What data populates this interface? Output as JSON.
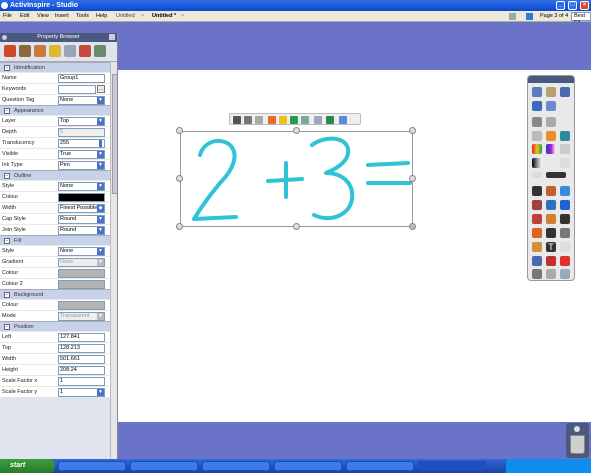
{
  "window": {
    "title": "ActivInspire - Studio"
  },
  "menu": [
    "File",
    "Edit",
    "View",
    "Insert",
    "Tools",
    "Help"
  ],
  "tabs": {
    "untitled_plain": "Untitled",
    "untitled_active": "Untitled *"
  },
  "pagebar": {
    "page_info": "Page 3 of 4",
    "zoom": "Best Fit"
  },
  "property_browser": {
    "title": "Property Browser",
    "sections": {
      "identification": "Identification",
      "appearance": "Appearance",
      "outline": "Outline",
      "fill": "Fill",
      "background": "Background",
      "position": "Position"
    },
    "identification": {
      "name_label": "Name",
      "name_value": "Group1",
      "keywords_label": "Keywords",
      "keywords_value": "",
      "question_tag_label": "Question Tag",
      "question_tag_value": "None"
    },
    "appearance": {
      "layer_label": "Layer",
      "layer_value": "Top",
      "depth_label": "Depth",
      "depth_value": "5",
      "translucency_label": "Translucency",
      "translucency_value": "255",
      "visible_label": "Visible",
      "visible_value": "True",
      "ink_type_label": "Ink Type",
      "ink_type_value": "Pen"
    },
    "outline": {
      "style_label": "Style",
      "style_value": "None",
      "colour_label": "Colour",
      "colour_value": "#000000",
      "width_label": "Width",
      "width_value": "Finest Possible",
      "cap_style_label": "Cap Style",
      "cap_style_value": "Round",
      "join_style_label": "Join Style",
      "join_style_value": "Round"
    },
    "fill": {
      "style_label": "Style",
      "style_value": "None",
      "gradient_label": "Gradient",
      "gradient_value": "None",
      "colour_label": "Colour",
      "colour2_label": "Colour 2"
    },
    "background": {
      "colour_label": "Colour",
      "mode_label": "Mode",
      "mode_value": "Transparent"
    },
    "position": {
      "left_label": "Left",
      "left_value": "127.841",
      "top_label": "Top",
      "top_value": "128.213",
      "width_label": "Width",
      "width_value": "501.661",
      "height_label": "Height",
      "height_value": "208.24",
      "scale_x_label": "Scale Factor x",
      "scale_x_value": "1",
      "scale_y_label": "Scale Factor y",
      "scale_y_value": "1"
    }
  },
  "canvas": {
    "ink_color": "#2ec4d6"
  },
  "taskbar": {
    "start_label": "start"
  },
  "colors": {
    "workspace": "#6b73c8",
    "titlebar": "#0a47d1",
    "panel_header": "#4a5a7e"
  }
}
